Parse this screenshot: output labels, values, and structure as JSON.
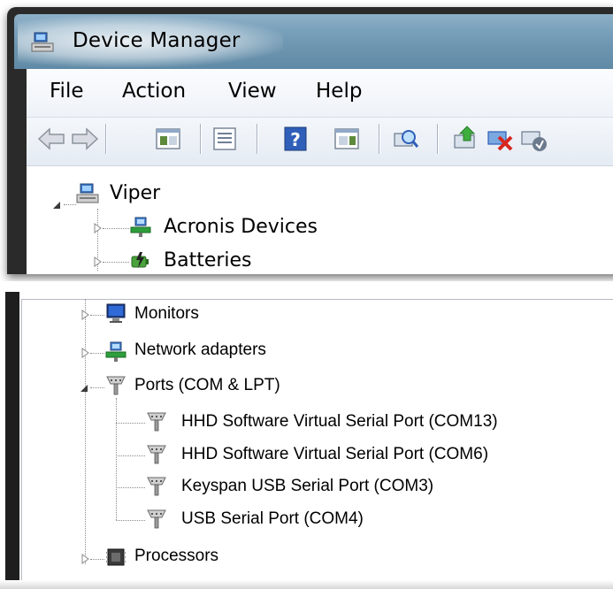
{
  "window": {
    "title": "Device Manager",
    "icon": "device-manager-icon"
  },
  "menu": {
    "items": [
      "File",
      "Action",
      "View",
      "Help"
    ]
  },
  "toolbar": {
    "buttons": [
      "back-arrow-icon",
      "forward-arrow-icon",
      "show-hide-console-tree-icon",
      "properties-icon",
      "help-icon",
      "action-pane-icon",
      "scan-hardware-changes-icon",
      "update-driver-icon",
      "uninstall-icon",
      "enable-device-icon"
    ]
  },
  "tree_top": {
    "root": {
      "label": "Viper",
      "icon": "computer-icon",
      "expanded": true
    },
    "children": [
      {
        "label": "Acronis Devices",
        "icon": "network-device-icon",
        "expanded": false
      },
      {
        "label": "Batteries",
        "icon": "battery-icon",
        "expanded": false
      }
    ]
  },
  "tree_bottom": {
    "items": [
      {
        "label": "Monitors",
        "icon": "monitor-icon",
        "expanded": false
      },
      {
        "label": "Network adapters",
        "icon": "network-adapter-icon",
        "expanded": false
      },
      {
        "label": "Ports (COM & LPT)",
        "icon": "port-icon",
        "expanded": true
      },
      {
        "label": "Processors",
        "icon": "processor-icon",
        "expanded": false
      }
    ],
    "ports": [
      {
        "label": "HHD Software Virtual Serial Port (COM13)",
        "icon": "port-icon"
      },
      {
        "label": "HHD Software Virtual Serial Port (COM6)",
        "icon": "port-icon"
      },
      {
        "label": "Keyspan USB Serial Port (COM3)",
        "icon": "port-icon"
      },
      {
        "label": "USB Serial Port (COM4)",
        "icon": "port-icon"
      }
    ]
  },
  "colors": {
    "title_glass": "#7aa1bb",
    "frame": "#2a2a2a",
    "menubar": "#f3f6fb",
    "toolbar": "#e9eef5"
  }
}
